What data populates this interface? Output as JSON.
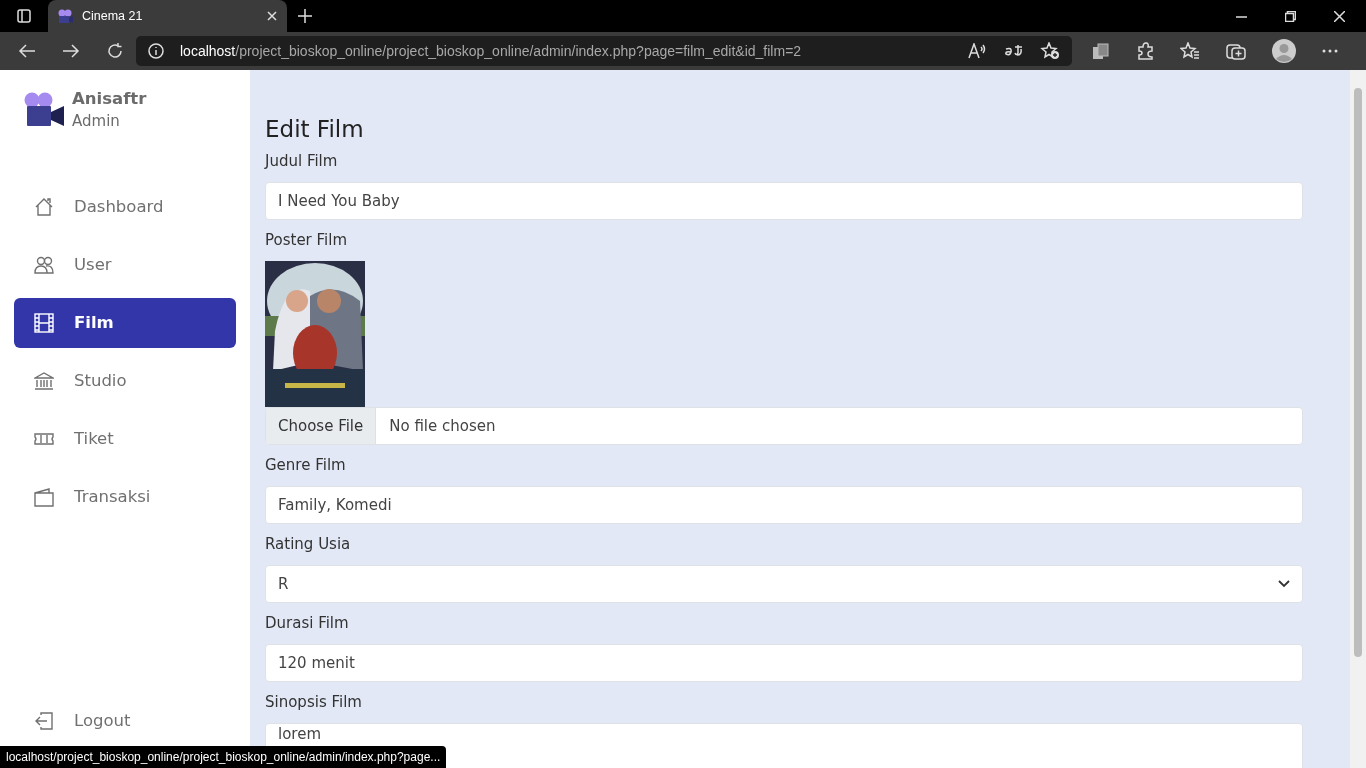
{
  "browser": {
    "tab_title": "Cinema 21",
    "url_host": "localhost",
    "url_path": "/project_bioskop_online/project_bioskop_online/admin/index.php?page=film_edit&id_film=2",
    "status_url": "localhost/project_bioskop_online/project_bioskop_online/admin/index.php?page..."
  },
  "sidebar": {
    "user_name": "Anisaftr",
    "role": "Admin",
    "items": [
      {
        "label": "Dashboard",
        "selected": false
      },
      {
        "label": "User",
        "selected": false
      },
      {
        "label": "Film",
        "selected": true
      },
      {
        "label": "Studio",
        "selected": false
      },
      {
        "label": "Tiket",
        "selected": false
      },
      {
        "label": "Transaksi",
        "selected": false
      }
    ],
    "logout": "Logout"
  },
  "form": {
    "title": "Edit Film",
    "fields": [
      {
        "kind": "text",
        "label": "Judul Film",
        "value": "I Need You Baby"
      },
      {
        "kind": "file",
        "label": "Poster Film",
        "button": "Choose File",
        "value": "No file chosen"
      },
      {
        "kind": "text",
        "label": "Genre Film",
        "value": "Family, Komedi"
      },
      {
        "kind": "select",
        "label": "Rating Usia",
        "value": "R"
      },
      {
        "kind": "text",
        "label": "Durasi Film",
        "value": "120 menit"
      },
      {
        "kind": "textarea",
        "label": "Sinopsis Film",
        "value": "lorem"
      }
    ]
  }
}
